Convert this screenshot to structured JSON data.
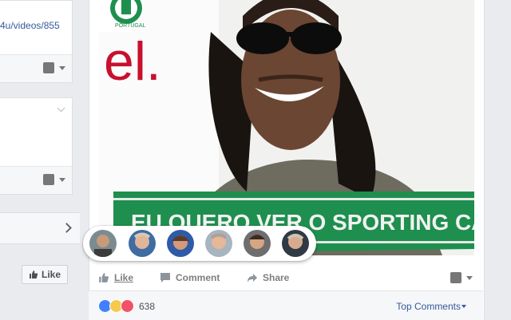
{
  "left_column": {
    "card1": {
      "link_text": "4u/videos/855"
    },
    "card2": {},
    "page_like_label": "Like"
  },
  "post": {
    "photo": {
      "logo_text": "PORTUGAL",
      "sign_text": "el.",
      "scarf_text": "EU QUERO VER O SPORTING CAMPEÃO!"
    },
    "reactions_tray_count": 6,
    "actions": {
      "like": "Like",
      "comment": "Comment",
      "share": "Share"
    },
    "summary": {
      "reaction_count": "638",
      "top_comments_label": "Top Comments"
    }
  },
  "colors": {
    "fb_blue": "#365899",
    "like_blue": "#4080ff",
    "love_red": "#f25268",
    "haha_yellow": "#f7c94e",
    "scarf_green": "#1e8f4e",
    "sign_red": "#c8102e"
  }
}
